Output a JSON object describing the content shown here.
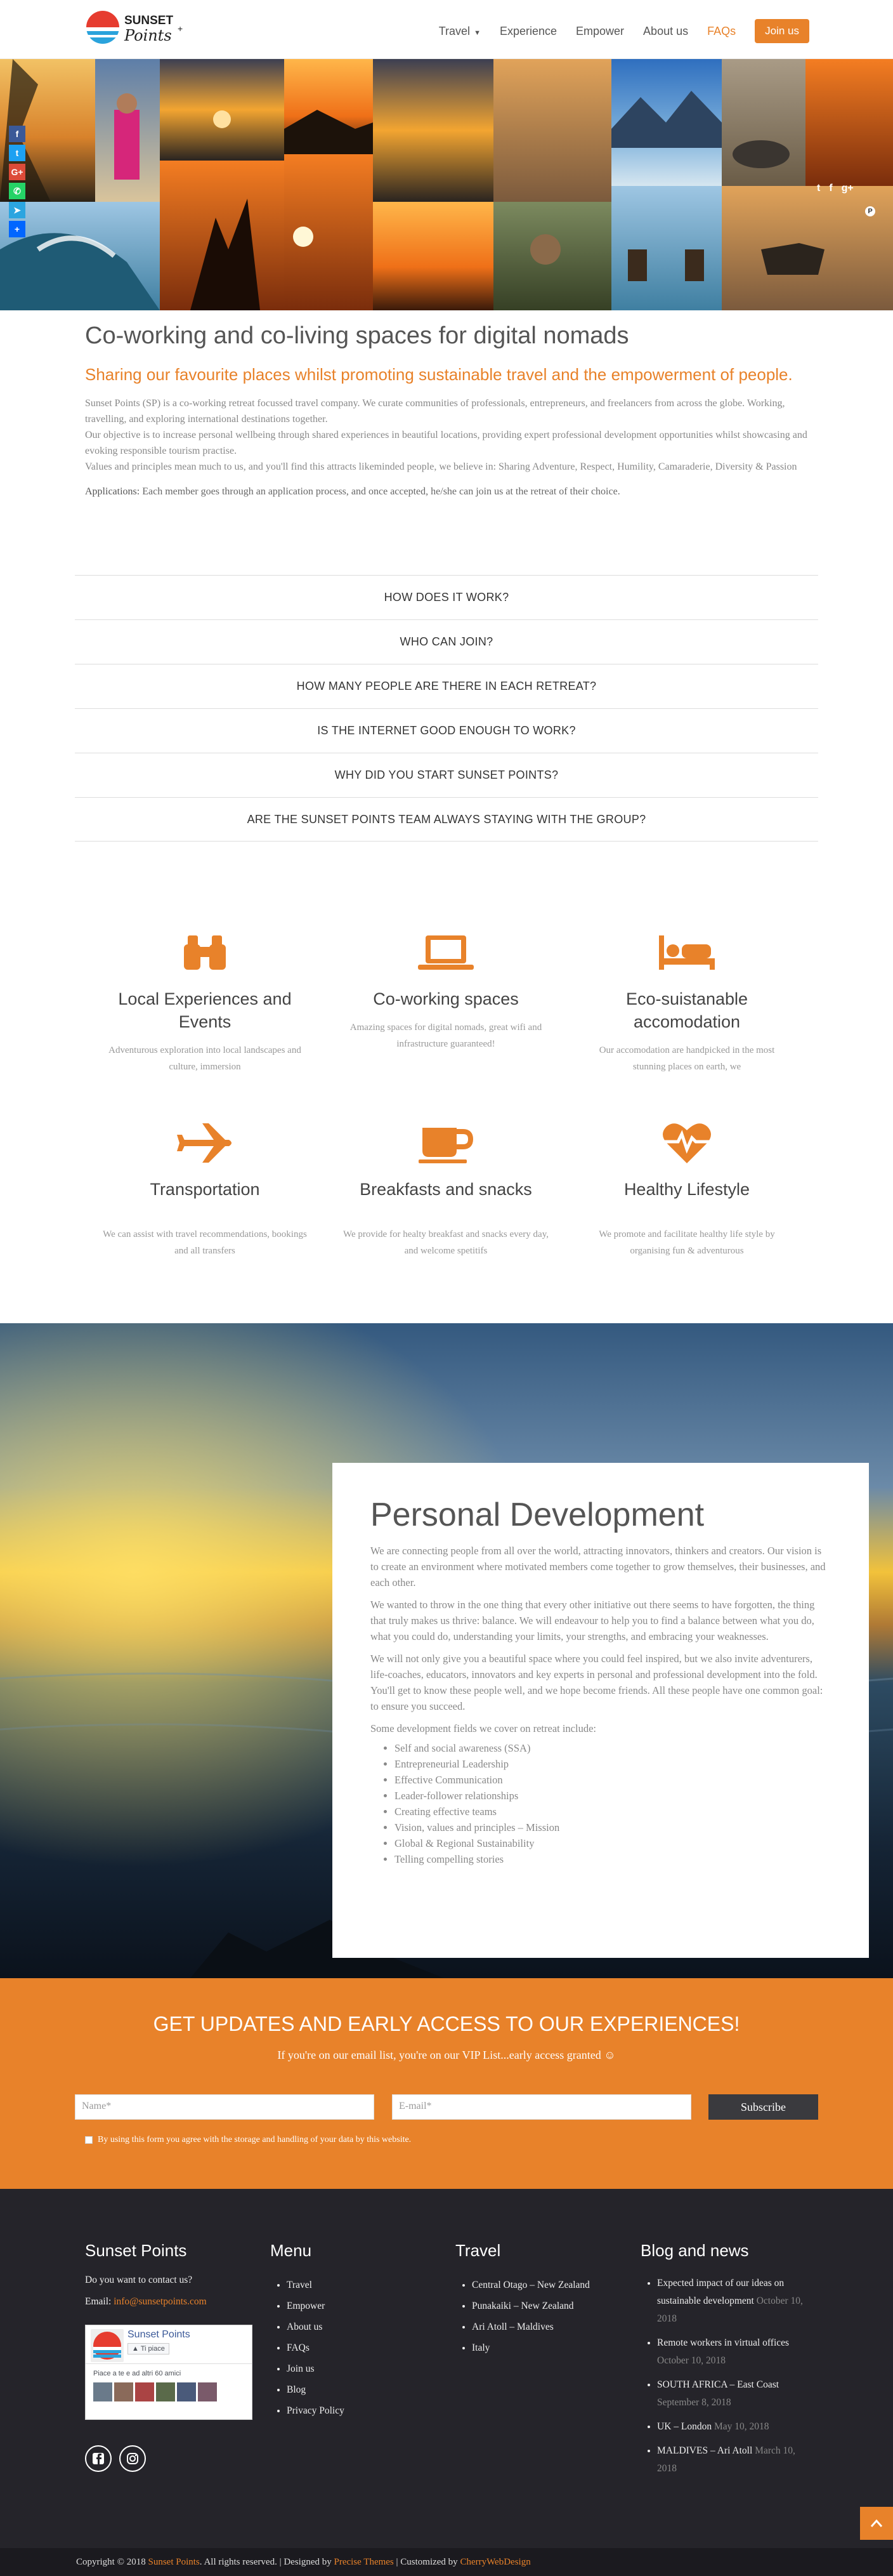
{
  "header": {
    "logo_line1": "SUNSET",
    "logo_line2": "Points",
    "nav": [
      {
        "label": "Travel",
        "dropdown": true
      },
      {
        "label": "Experience"
      },
      {
        "label": "Empower"
      },
      {
        "label": "About us"
      },
      {
        "label": "FAQs",
        "active": true
      }
    ],
    "join_label": "Join us"
  },
  "hero": {
    "share_icons": [
      "facebook-icon",
      "twitter-icon",
      "google-plus-icon",
      "whatsapp-icon",
      "telegram-icon",
      "share-plus-icon"
    ],
    "social_icons": [
      "twitter-icon",
      "facebook-icon",
      "google-plus-icon",
      "pinterest-icon"
    ]
  },
  "intro": {
    "title": "Co-working and co-living spaces for digital nomads",
    "subtitle": "Sharing our favourite places whilst promoting sustainable travel and the empowerment of people.",
    "p1": "Sunset Points (SP) is a co-working retreat focussed travel company. We curate communities of professionals, entrepreneurs, and freelancers from across the globe. Working, travelling, and exploring international destinations together.",
    "p2": "Our objective is to increase personal wellbeing through shared experiences in beautiful locations, providing expert professional development opportunities whilst showcasing and evoking responsible tourism practise.",
    "p3": "Values and principles mean much to us, and you'll find this attracts likeminded people, we believe in: Sharing Adventure, Respect, Humility, Camaraderie, Diversity & Passion",
    "apps_label": "Applications:",
    "apps_text": " Each member goes through an application process, and once accepted, he/she can join us at the retreat of their choice."
  },
  "faq": [
    "HOW DOES IT WORK?",
    "WHO CAN JOIN?",
    "HOW MANY PEOPLE ARE THERE IN EACH RETREAT?",
    "IS THE INTERNET GOOD ENOUGH TO WORK?",
    "WHY DID YOU START SUNSET POINTS?",
    "ARE THE SUNSET POINTS TEAM ALWAYS STAYING WITH THE GROUP?"
  ],
  "features": [
    {
      "icon": "binoculars-icon",
      "title": "Local Experiences and Events",
      "text": "Adventurous exploration into local landscapes and culture, immersion"
    },
    {
      "icon": "laptop-icon",
      "title": "Co-working spaces",
      "text": "Amazing spaces for digital nomads, great wifi and infrastructure guaranteed!"
    },
    {
      "icon": "bed-icon",
      "title": "Eco-suistanable accomodation",
      "text": "Our accomodation are handpicked in the most stunning places on earth, we"
    },
    {
      "icon": "airplane-icon",
      "title": "Transportation",
      "text": "We can assist with travel recommendations, bookings and all transfers"
    },
    {
      "icon": "coffee-cup-icon",
      "title": "Breakfasts and snacks",
      "text": "We provide for healty breakfast and snacks every day, and welcome spetitifs"
    },
    {
      "icon": "heartbeat-icon",
      "title": "Healthy Lifestyle",
      "text": "We promote and facilitate healthy life style by organising fun & adventurous"
    }
  ],
  "personal_dev": {
    "title": "Personal Development",
    "p1": "We are connecting people from all over the world, attracting innovators, thinkers and creators. Our vision is to create an environment where motivated members come together to grow themselves, their businesses, and each other.",
    "p2": "We wanted to throw in the one thing that every other initiative out there seems to have forgotten, the thing that truly makes us thrive: balance. We will endeavour to help you to find a balance between what you do, what you could do, understanding your limits, your strengths, and embracing your weaknesses.",
    "p3": "We will not only give you a beautiful space where you could feel inspired, but we also invite adventurers, life-coaches, educators, innovators and key experts in personal and professional development into the fold.",
    "p4": "You'll get to know these people well, and we hope become friends. All these people have one common goal: to ensure you succeed.",
    "p5": "Some development fields we cover on retreat include:",
    "list": [
      "Self and social awareness (SSA)",
      "Entrepreneurial Leadership",
      "Effective Communication",
      "Leader-follower relationships",
      "Creating effective teams",
      "Vision, values and principles – Mission",
      "Global & Regional Sustainability",
      "Telling compelling stories"
    ]
  },
  "updates": {
    "title": "GET UPDATES AND EARLY ACCESS TO OUR EXPERIENCES!",
    "subtitle": "If you're on our email list, you're on our VIP List...early access granted ☺",
    "name_placeholder": "Name*",
    "email_placeholder": "E-mail*",
    "subscribe_label": "Subscribe",
    "consent": "By using this form you agree with the storage and handling of your data by this website."
  },
  "footer": {
    "col1": {
      "title": "Sunset Points",
      "contact": "Do you want to contact us?",
      "email_label": "Email: ",
      "email": "info@sunsetpoints.com",
      "fb_name": "Sunset Points",
      "fb_like": "Ti piace",
      "fb_friends": "Piace a te e ad altri 60 amici"
    },
    "col2": {
      "title": "Menu",
      "items": [
        "Travel",
        "Empower",
        "About us",
        "FAQs",
        "Join us",
        "Blog",
        "Privacy Policy"
      ]
    },
    "col3": {
      "title": "Travel",
      "items": [
        "Central Otago – New Zealand",
        "Punakaiki – New Zealand",
        "Ari Atoll – Maldives",
        "Italy"
      ]
    },
    "col4": {
      "title": "Blog and news",
      "posts": [
        {
          "title": "Expected impact of our ideas on sustainable development",
          "date": "October 10, 2018"
        },
        {
          "title": "Remote workers in virtual offices",
          "date": "October 10, 2018"
        },
        {
          "title": "SOUTH AFRICA – East Coast",
          "date": "September 8, 2018"
        },
        {
          "title": "UK – London",
          "date": "May 10, 2018"
        },
        {
          "title": "MALDIVES – Ari Atoll",
          "date": "March 10, 2018"
        }
      ]
    },
    "copyright_a": "Copyright © 2018 ",
    "copyright_b": "Sunset Points",
    "copyright_c": ". All rights reserved. | Designed by ",
    "copyright_d": "Precise Themes",
    "copyright_e": " | Customized by ",
    "copyright_f": "CherryWebDesign"
  },
  "colors": {
    "accent": "#e8822a",
    "footer_bg": "#25242a",
    "text": "#555555"
  }
}
